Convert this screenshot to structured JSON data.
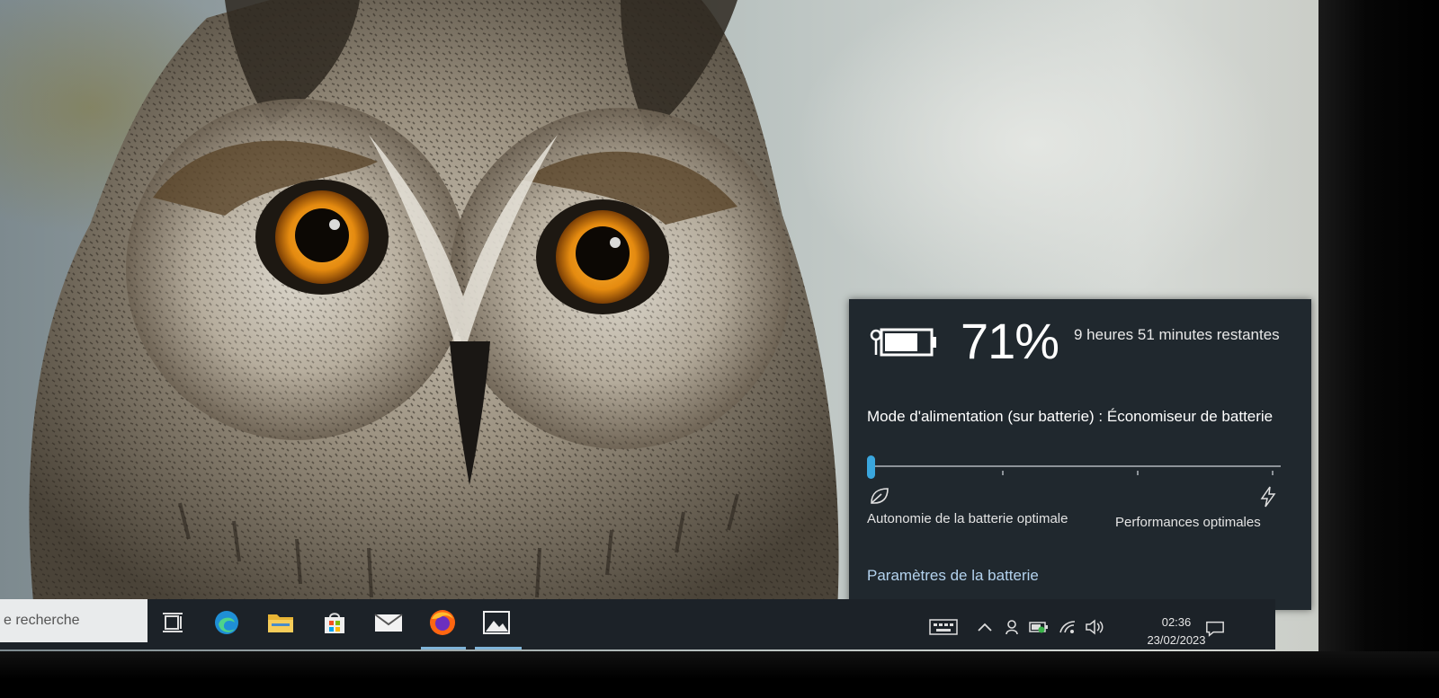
{
  "battery_flyout": {
    "percent": "71%",
    "remaining_time": "9 heures 51 minutes restantes",
    "power_mode": "Mode d'alimentation (sur batterie) : Économiseur de batterie",
    "slider_value": 0,
    "left_label": "Autonomie de la batterie optimale",
    "right_label": "Performances optimales",
    "settings_link": "Paramètres de la batterie",
    "accent_color": "#3aa6dd"
  },
  "taskbar": {
    "search_placeholder": "e recherche",
    "pinned_apps": [
      "task-view-icon",
      "edge-icon",
      "file-explorer-icon",
      "store-icon",
      "mail-icon",
      "firefox-icon",
      "photos-icon"
    ],
    "tray_icons": [
      "keyboard-icon",
      "chevron-up-icon",
      "meet-now-icon",
      "battery-icon",
      "wifi-icon",
      "volume-icon"
    ],
    "time": "02:36",
    "date": "23/02/2023",
    "notification_icon": "action-center-icon"
  },
  "wallpaper": "long-eared owl"
}
